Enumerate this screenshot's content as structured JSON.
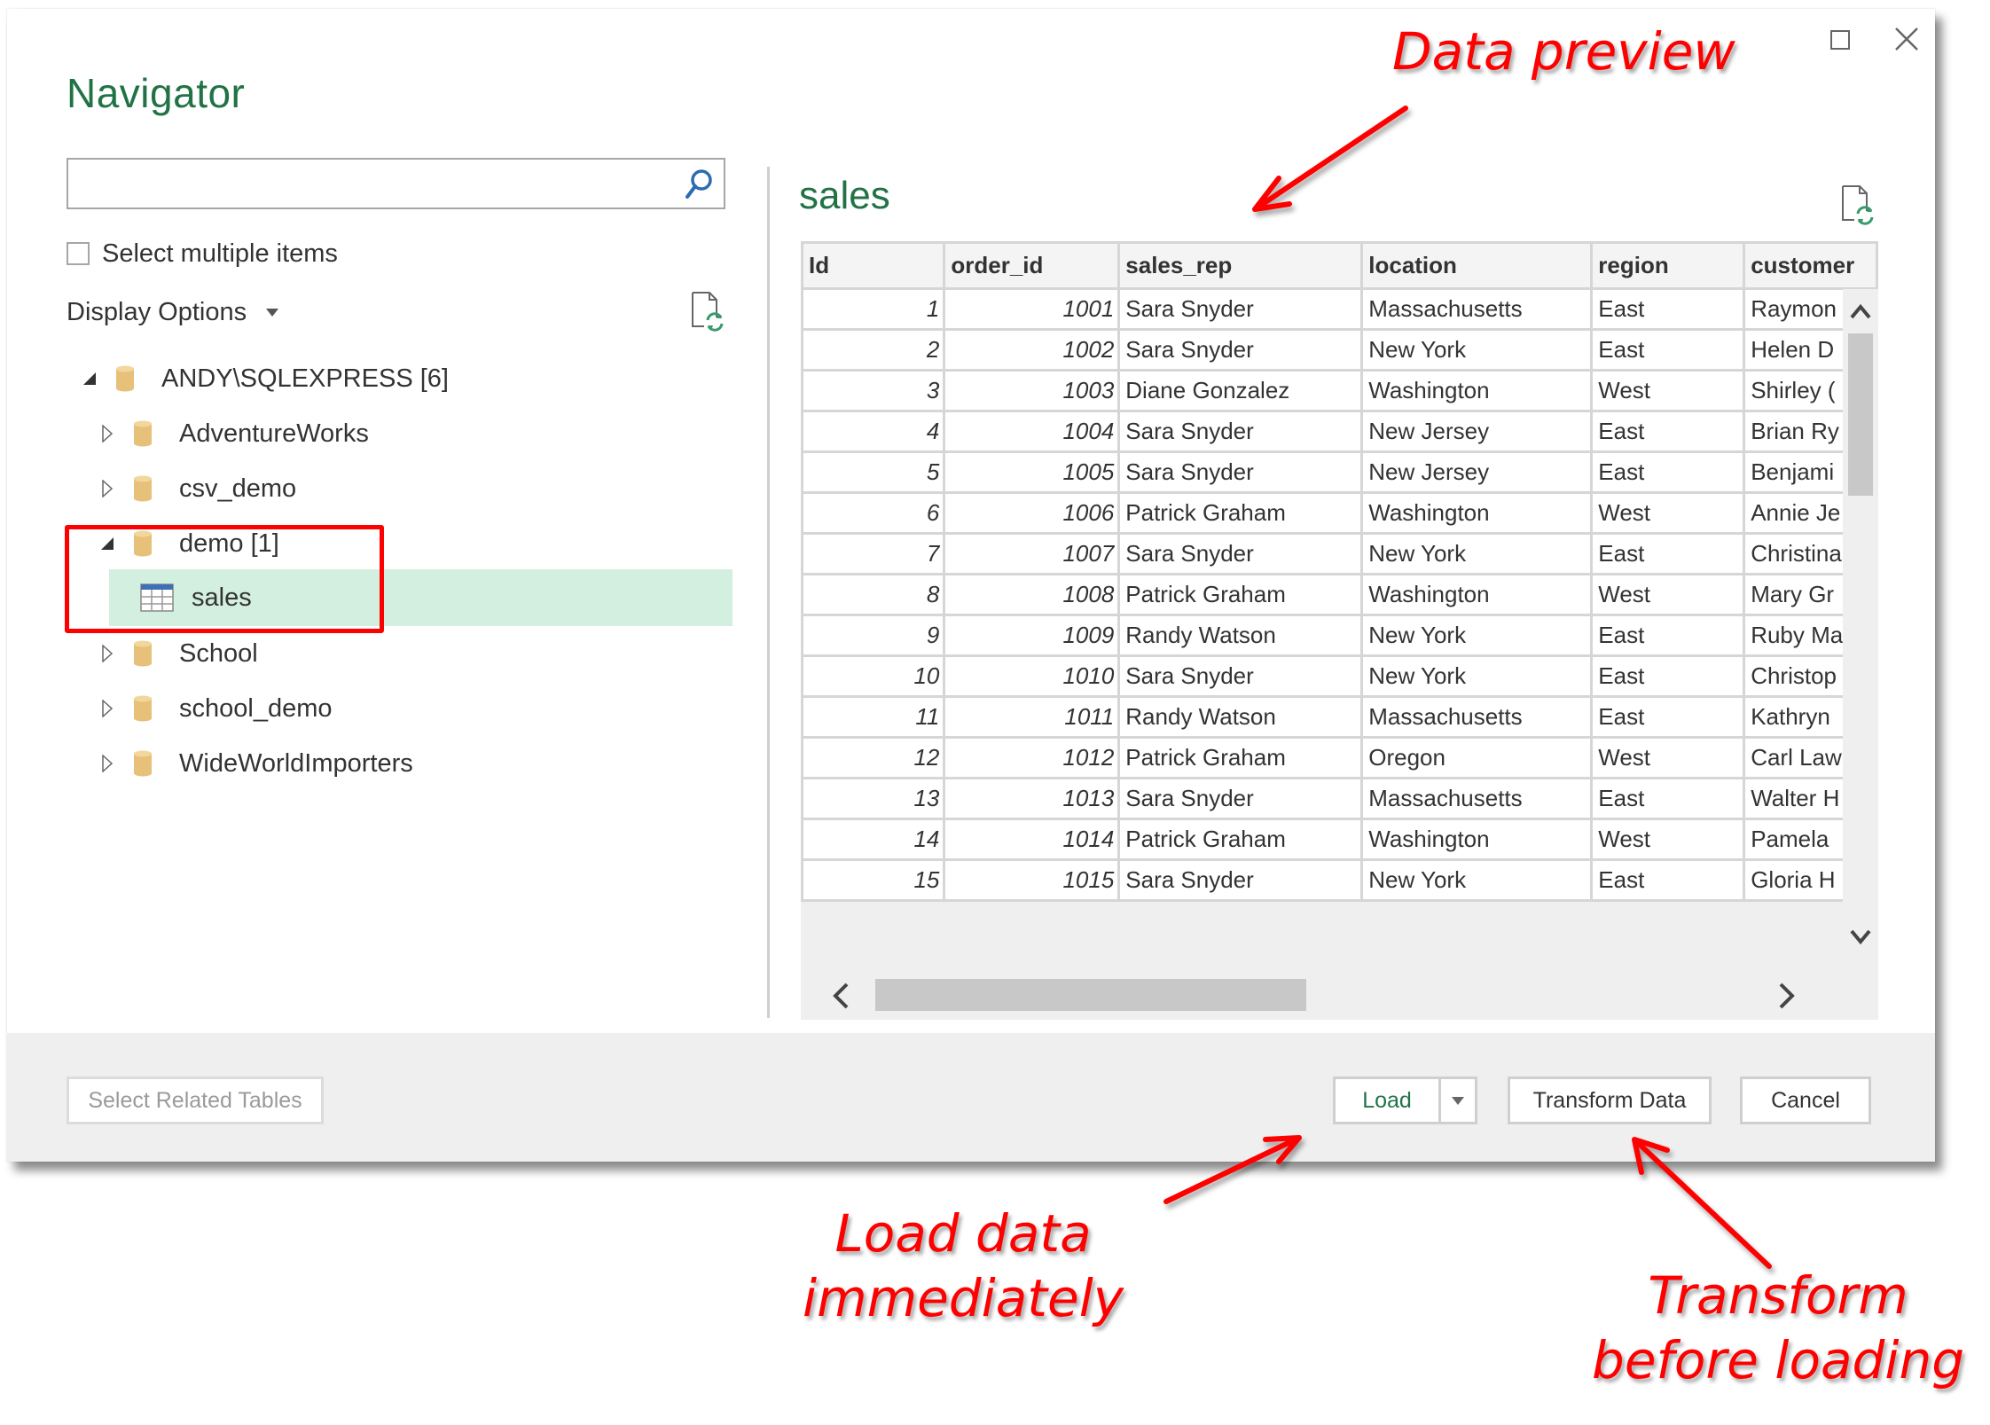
{
  "window": {
    "title": "Navigator",
    "controls": [
      {
        "name": "maximize",
        "icon": "maximize-icon"
      },
      {
        "name": "close",
        "icon": "close-icon"
      }
    ]
  },
  "left_pane": {
    "search": {
      "value": "",
      "placeholder": "",
      "icon": "search-icon"
    },
    "select_multiple": {
      "label": "Select multiple items",
      "checked": false
    },
    "display_options": {
      "label": "Display Options",
      "icon": "chevron-down-icon"
    },
    "refresh_icon": "refresh-icon",
    "tree": [
      {
        "label": "ANDY\\SQLEXPRESS [6]",
        "level": 0,
        "expanded": true,
        "icon": "database-icon"
      },
      {
        "label": "AdventureWorks",
        "level": 1,
        "expanded": false,
        "icon": "database-icon"
      },
      {
        "label": "csv_demo",
        "level": 1,
        "expanded": false,
        "icon": "database-icon"
      },
      {
        "label": "demo [1]",
        "level": 1,
        "expanded": true,
        "icon": "database-icon"
      },
      {
        "label": "sales",
        "level": 2,
        "selected": true,
        "icon": "table-icon"
      },
      {
        "label": "School",
        "level": 1,
        "expanded": false,
        "icon": "database-icon"
      },
      {
        "label": "school_demo",
        "level": 1,
        "expanded": false,
        "icon": "database-icon"
      },
      {
        "label": "WideWorldImporters",
        "level": 1,
        "expanded": false,
        "icon": "database-icon"
      }
    ]
  },
  "preview": {
    "title": "sales",
    "refresh_icon": "refresh-icon",
    "columns": [
      "Id",
      "order_id",
      "sales_rep",
      "location",
      "region",
      "customer"
    ],
    "rows": [
      [
        "1",
        "1001",
        "Sara Snyder",
        "Massachusetts",
        "East",
        "Raymon"
      ],
      [
        "2",
        "1002",
        "Sara Snyder",
        "New York",
        "East",
        "Helen D"
      ],
      [
        "3",
        "1003",
        "Diane Gonzalez",
        "Washington",
        "West",
        "Shirley ("
      ],
      [
        "4",
        "1004",
        "Sara Snyder",
        "New Jersey",
        "East",
        "Brian Ry"
      ],
      [
        "5",
        "1005",
        "Sara Snyder",
        "New Jersey",
        "East",
        "Benjami"
      ],
      [
        "6",
        "1006",
        "Patrick Graham",
        "Washington",
        "West",
        "Annie Je"
      ],
      [
        "7",
        "1007",
        "Sara Snyder",
        "New York",
        "East",
        "Christina"
      ],
      [
        "8",
        "1008",
        "Patrick Graham",
        "Washington",
        "West",
        "Mary Gr"
      ],
      [
        "9",
        "1009",
        "Randy Watson",
        "New York",
        "East",
        "Ruby Ma"
      ],
      [
        "10",
        "1010",
        "Sara Snyder",
        "New York",
        "East",
        "Christop"
      ],
      [
        "11",
        "1011",
        "Randy Watson",
        "Massachusetts",
        "East",
        "Kathryn"
      ],
      [
        "12",
        "1012",
        "Patrick Graham",
        "Oregon",
        "West",
        "Carl Law"
      ],
      [
        "13",
        "1013",
        "Sara Snyder",
        "Massachusetts",
        "East",
        "Walter H"
      ],
      [
        "14",
        "1014",
        "Patrick Graham",
        "Washington",
        "West",
        "Pamela"
      ],
      [
        "15",
        "1015",
        "Sara Snyder",
        "New York",
        "East",
        "Gloria H"
      ]
    ]
  },
  "footer": {
    "select_related": "Select Related Tables",
    "load": "Load",
    "transform": "Transform Data",
    "cancel": "Cancel"
  },
  "annotations": {
    "data_preview": "Data preview",
    "load_line1": "Load data",
    "load_line2": "immediately",
    "transform_line1": "Transform",
    "transform_line2": "before loading"
  },
  "colors": {
    "accent": "#217346",
    "selection": "#d3efdf",
    "annotation": "#ff0000",
    "db_icon": "#e7c07a"
  }
}
